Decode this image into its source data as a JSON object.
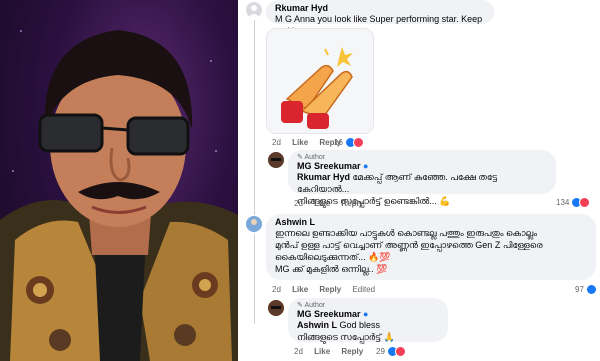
{
  "comments": [
    {
      "author": "Rkumar Hyd",
      "text": "M G Anna you look like Super performing star. Keep rocking.",
      "time": "2d",
      "like": "Like",
      "reply": "Reply",
      "reactions": "16"
    },
    {
      "badge": "Author",
      "author": "MG Sreekumar",
      "tagged": "Rkumar Hyd",
      "text1": "മേക്കപ്പ് ആണ് കുഞ്ഞേ. പക്ഷേ തട്ടേ കേറിയാൽ...",
      "text2": "നിങ്ങളുടെ സപ്പോർട്ട് ഉണ്ടെങ്കിൽ...",
      "time": "2d",
      "like": "Like",
      "reply": "Reply",
      "reactions": "134"
    },
    {
      "author": "Ashwin L",
      "text1": "ഇന്നലെ ഉണ്ടാക്കിയ പാട്ടുകൾ കൊണ്ടല്ല പത്തും ഇരുപതും കൊല്ലം",
      "text2": "മുൻപ് ഉള്ള പാട്ട് വെച്ചാണ് അണ്ണൻ ഇപ്പോഴത്തെ Gen Z പിള്ളേരെ",
      "text3": "കൈയിലെടുക്കുന്നത്...",
      "text4": "MG ക്ക് മുകളിൽ ഒന്നില്ല..",
      "time": "2d",
      "like": "Like",
      "reply": "Reply",
      "edited": "Edited",
      "reactions": "97"
    },
    {
      "badge": "Author",
      "author": "MG Sreekumar",
      "tagged": "Ashwin L",
      "text1": "God bless",
      "text2": "നിങ്ങളുടെ സപ്പോർട്ട്",
      "time": "2d",
      "like": "Like",
      "reply": "Reply",
      "reactions": "29"
    }
  ]
}
